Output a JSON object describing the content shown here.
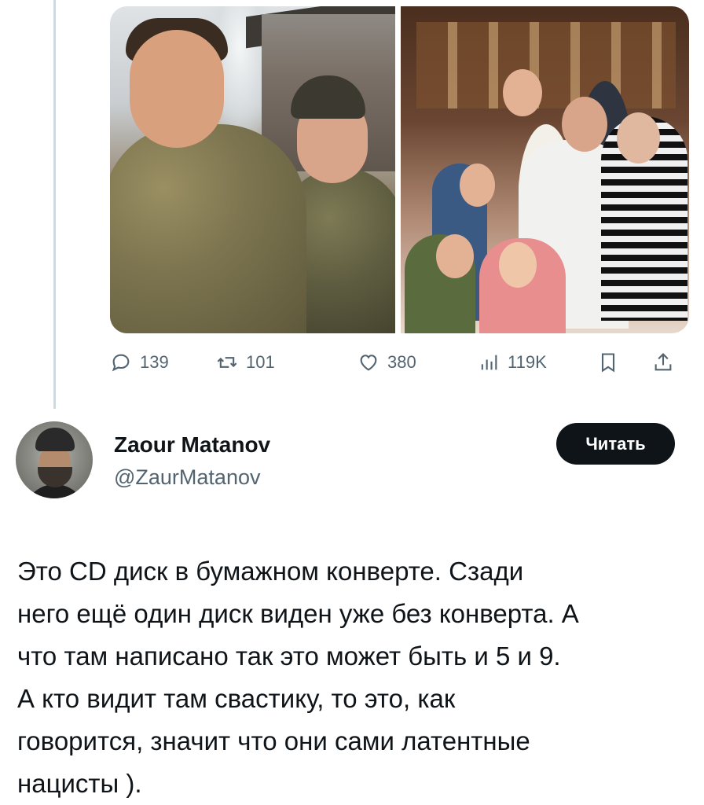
{
  "post": {
    "media": [
      {
        "alt_icon": "photo-two-soldiers"
      },
      {
        "alt_icon": "photo-family-group"
      }
    ],
    "actions": {
      "reply_count": "139",
      "retweet_count": "101",
      "like_count": "380",
      "views_count": "119K"
    }
  },
  "reply": {
    "author_name": "Zaour Matanov",
    "author_handle": "@ZaurMatanov",
    "follow_label": "Читать",
    "text": "Это CD диск в бумажном конверте. Сзади\nнего ещё один диск виден уже без конверта. А\nчто там написано так это может быть и 5 и 9.\nА кто видит там свастику, то это, как\nговорится, значит что они сами латентные\nнацисты )."
  },
  "colors": {
    "text_primary": "#0f1419",
    "text_secondary": "#536471",
    "thread_line": "#cfd9de",
    "button_bg": "#0f1419"
  }
}
